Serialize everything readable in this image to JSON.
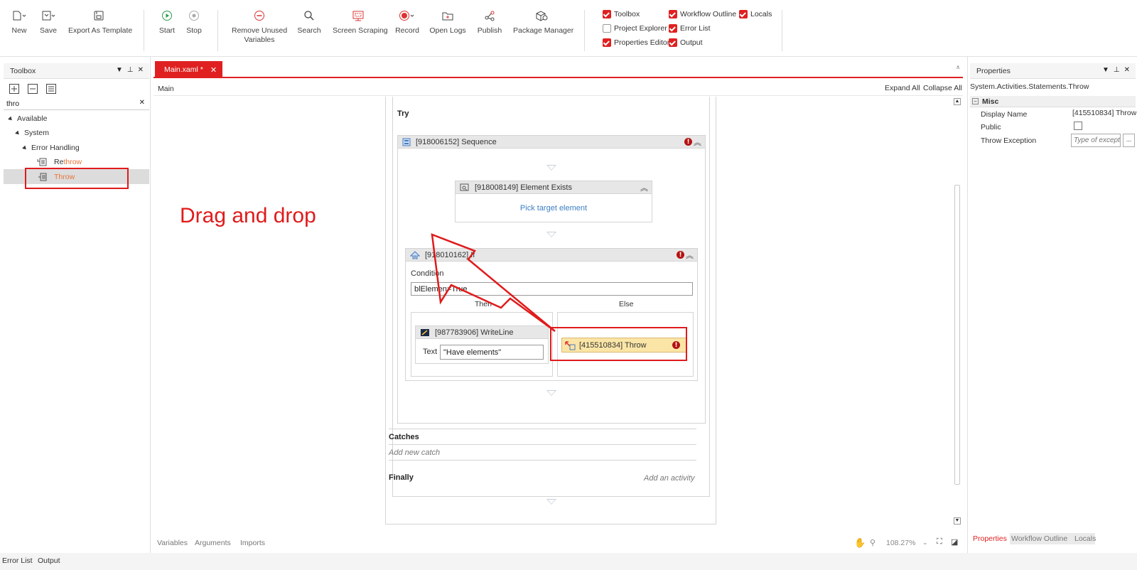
{
  "ribbon": {
    "buttons": [
      {
        "id": "new",
        "label": "New",
        "icon": "new-file-icon"
      },
      {
        "id": "save",
        "label": "Save",
        "icon": "save-icon"
      },
      {
        "id": "export",
        "label": "Export As Template",
        "icon": "export-template-icon"
      },
      {
        "id": "start",
        "label": "Start",
        "icon": "play-icon"
      },
      {
        "id": "stop",
        "label": "Stop",
        "icon": "stop-icon"
      },
      {
        "id": "remove",
        "label": "Remove Unused Variables",
        "icon": "remove-icon"
      },
      {
        "id": "search",
        "label": "Search",
        "icon": "search-icon"
      },
      {
        "id": "scraping",
        "label": "Screen Scraping",
        "icon": "screen-scraping-icon"
      },
      {
        "id": "record",
        "label": "Record",
        "icon": "record-icon"
      },
      {
        "id": "logs",
        "label": "Open Logs",
        "icon": "folder-icon"
      },
      {
        "id": "publish",
        "label": "Publish",
        "icon": "share-icon"
      },
      {
        "id": "packages",
        "label": "Package Manager",
        "icon": "package-icon"
      }
    ],
    "remove_label_line1": "Remove Unused",
    "remove_label_line2": "Variables",
    "checkboxes": [
      {
        "label": "Toolbox",
        "checked": true
      },
      {
        "label": "Project Explorer",
        "checked": false
      },
      {
        "label": "Properties Editor",
        "checked": true
      },
      {
        "label": "Workflow Outline",
        "checked": true
      },
      {
        "label": "Error List",
        "checked": true
      },
      {
        "label": "Output",
        "checked": true
      },
      {
        "label": "Locals",
        "checked": true
      }
    ]
  },
  "toolbox": {
    "title": "Toolbox",
    "search_value": "thro",
    "tree": {
      "available": "Available",
      "system": "System",
      "error_handling": "Error Handling",
      "rethrow_prefix": "Re",
      "rethrow_match": "throw",
      "throw_match": "Thro",
      "throw_suffix": "w"
    }
  },
  "annotation": {
    "text": "Drag and drop",
    "color": "#e01b1b"
  },
  "editor": {
    "tab_label": "Main.xaml *",
    "breadcrumb": "Main",
    "expand_all": "Expand All",
    "collapse_all": "Collapse All",
    "try_label": "Try",
    "sequence_title": "[918006152] Sequence",
    "element_exists_title": "[918008149] Element Exists",
    "pick_target": "Pick target element",
    "if_title": "[918010162] If",
    "condition_label": "Condition",
    "condition_value": "blElemen=True",
    "then_label": "Then",
    "else_label": "Else",
    "writeline_title": "[987783906] WriteLine",
    "text_label": "Text",
    "text_value": "\"Have elements\"",
    "throw_title": "[415510834] Throw",
    "catches_label": "Catches",
    "add_catch": "Add new catch",
    "finally_label": "Finally",
    "add_activity": "Add an activity",
    "bottom_tabs": [
      "Variables",
      "Arguments",
      "Imports"
    ],
    "zoom": "108.27%"
  },
  "properties": {
    "title": "Properties",
    "type_name": "System.Activities.Statements.Throw",
    "category": "Misc",
    "rows": [
      {
        "name": "Display Name",
        "value": "[415510834] Throw"
      },
      {
        "name": "Public",
        "value": ""
      },
      {
        "name": "Throw Exception",
        "value": "",
        "placeholder": "Type of except"
      }
    ],
    "ellipsis": "...",
    "bottom_tabs": [
      "Properties",
      "Workflow Outline",
      "Locals"
    ]
  },
  "statusbar": {
    "tabs": [
      "Error List",
      "Output"
    ]
  },
  "colors": {
    "accent": "#e02020",
    "throw_bg": "#fbe5a6",
    "link": "#3b7fc4"
  }
}
